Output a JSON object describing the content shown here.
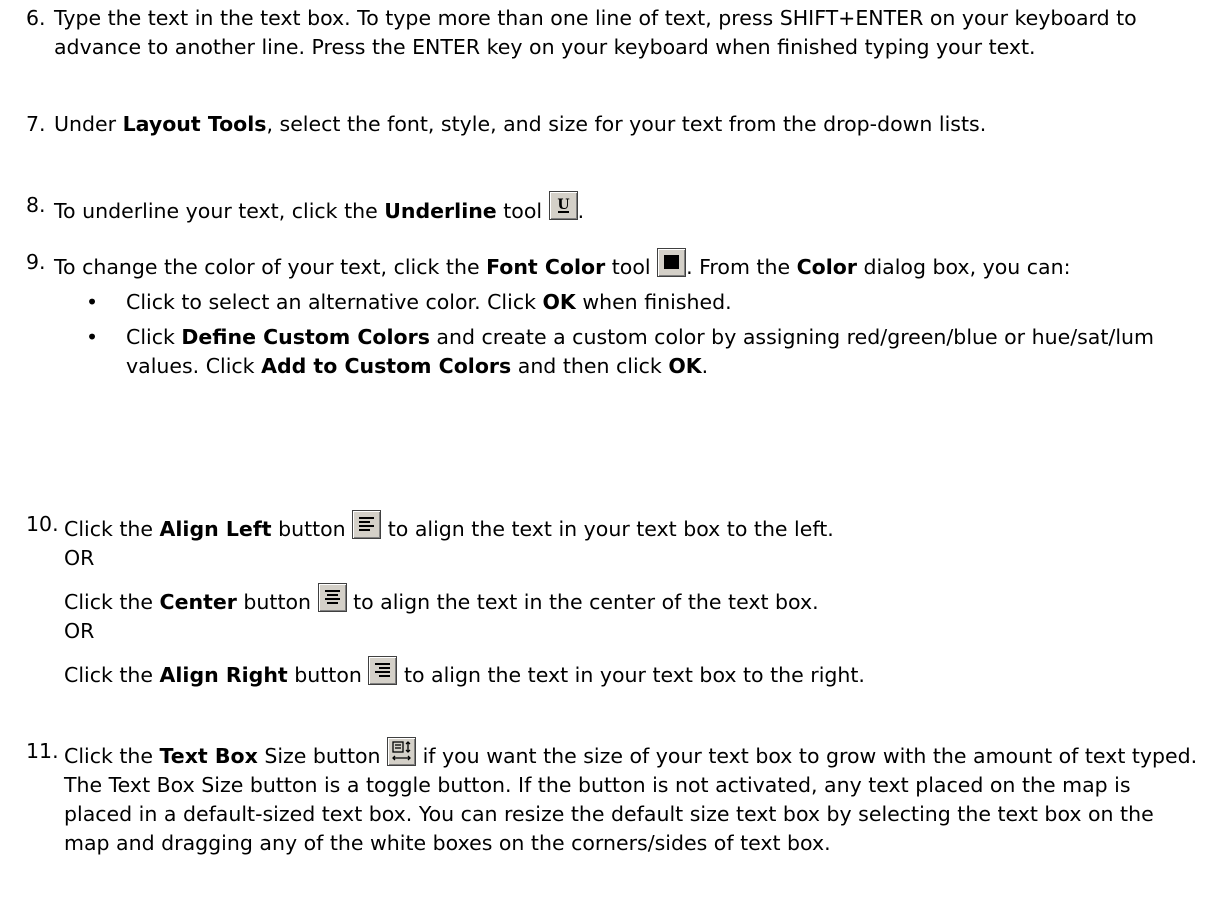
{
  "steps": [
    {
      "num": "6.",
      "text": "Type the text in the text box. To type more than one line of text, press SHIFT+ENTER on your keyboard to advance to another line. Press the ENTER key on your keyboard when finished typing your text."
    },
    {
      "num": "7.",
      "pre": "Under ",
      "bold": "Layout Tools",
      "post": ", select the font, style, and size for your text from the drop-down lists."
    },
    {
      "num": "8.",
      "pre": "To underline your text, click the ",
      "bold": "Underline",
      "post": " tool",
      "end": ".",
      "icon": "underline-tool-icon"
    },
    {
      "num": "9.",
      "pre": "To change the color of your text, click the ",
      "bold": "Font Color",
      "mid": " tool",
      "post": ". From the ",
      "bold2": "Color",
      "post2": " dialog box, you can:",
      "icon": "font-color-tool-icon",
      "bullets": [
        {
          "pre": "Click to select an alternative color. Click ",
          "bold": "OK",
          "post": " when finished."
        },
        {
          "pre": "Click ",
          "bold": "Define Custom Colors",
          "mid": " and create a custom color by assigning red/green/blue or hue/sat/lum values. Click ",
          "bold2": "Add to Custom Colors",
          "post": " and then click ",
          "bold3": "OK",
          "end": "."
        }
      ]
    },
    {
      "num": "10.",
      "parts": [
        {
          "pre": "Click the ",
          "bold": "Align Left",
          "post": " button",
          "after": " to align the text in your text box to the left.",
          "or": "OR",
          "icon": "align-left-icon"
        },
        {
          "pre": "Click the ",
          "bold": "Center",
          "post": " button",
          "after": "  to align the text in the center of the text box.",
          "or": "OR",
          "icon": "align-center-icon"
        },
        {
          "pre": "Click the ",
          "bold": "Align Right",
          "post": " button",
          "after": "  to align the text in your text box to the right.",
          "icon": "align-right-icon"
        }
      ]
    },
    {
      "num": "11.",
      "pre": "Click the ",
      "bold": "Text Box",
      "post": " Size button",
      "after": " if you want the size of your text box to grow with the amount of text typed.",
      "note": "The Text Box Size button is a toggle button. If the button is not activated, any text placed on the map is placed in a default-sized text box. You can resize the default size text box by selecting the text box on the map and dragging any of the white boxes on the corners/sides of text box.",
      "icon": "text-box-size-icon"
    }
  ]
}
